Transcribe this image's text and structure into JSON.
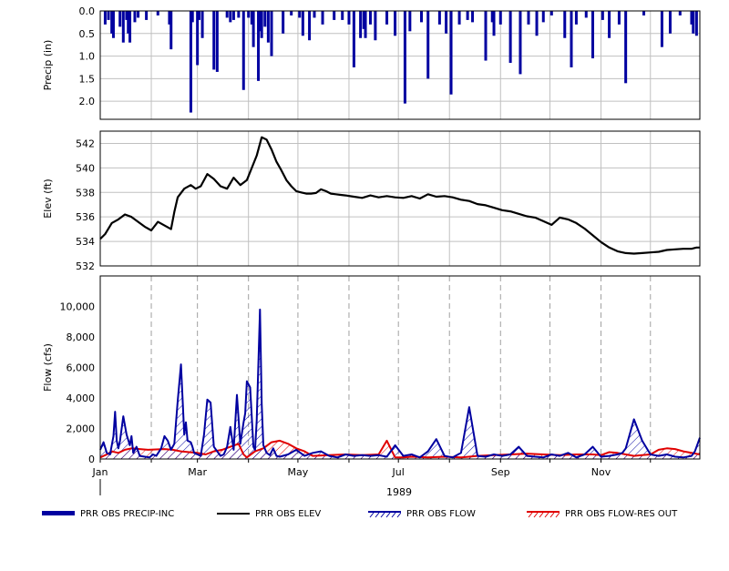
{
  "chart_data": [
    {
      "type": "bar",
      "panel": "precip",
      "ylabel": "Precip (in)",
      "y_inverted": true,
      "ylim": [
        0,
        2.4
      ],
      "yticks": [
        "0.0",
        "0.5",
        "1.0",
        "1.5",
        "2.0"
      ],
      "grid": true,
      "series": [
        {
          "name": "PRR OBS PRECIP-INC",
          "color": "#0000a0",
          "x_day_of_year": [
            4,
            6,
            8,
            9,
            13,
            15,
            17,
            18,
            19,
            22,
            24,
            29,
            36,
            43,
            44,
            56,
            57,
            60,
            61,
            63,
            70,
            72,
            78,
            80,
            82,
            85,
            88,
            91,
            93,
            94,
            97,
            98,
            99,
            101,
            103,
            105,
            112,
            117,
            122,
            124,
            128,
            131,
            136,
            143,
            148,
            152,
            155,
            159,
            161,
            162,
            165,
            168,
            175,
            180,
            186,
            189,
            196,
            200,
            207,
            211,
            214,
            219,
            224,
            227,
            235,
            239,
            240,
            244,
            250,
            256,
            261,
            266,
            270,
            275,
            283,
            287,
            290,
            296,
            300,
            306,
            310,
            316,
            320,
            331,
            342,
            347,
            353,
            360,
            361,
            363
          ],
          "values": [
            0.3,
            0.2,
            0.5,
            0.6,
            0.35,
            0.7,
            0.2,
            0.5,
            0.7,
            0.25,
            0.15,
            0.2,
            0.1,
            0.3,
            0.85,
            2.25,
            0.25,
            1.2,
            0.2,
            0.6,
            1.3,
            1.35,
            0.15,
            0.25,
            0.2,
            0.15,
            1.75,
            0.15,
            0.3,
            0.8,
            1.55,
            0.45,
            0.6,
            0.35,
            0.7,
            1.0,
            0.5,
            0.1,
            0.15,
            0.55,
            0.65,
            0.15,
            0.3,
            0.2,
            0.2,
            0.3,
            1.25,
            0.6,
            0.4,
            0.6,
            0.3,
            0.65,
            0.3,
            0.55,
            2.05,
            0.45,
            0.25,
            1.5,
            0.3,
            0.5,
            1.85,
            0.3,
            0.2,
            0.25,
            1.1,
            0.25,
            0.55,
            0.3,
            1.15,
            1.4,
            0.3,
            0.55,
            0.25,
            0.1,
            0.6,
            1.25,
            0.3,
            0.15,
            1.05,
            0.2,
            0.6,
            0.3,
            1.6,
            0.1,
            0.8,
            0.5,
            0.1,
            0.3,
            0.5,
            0.55
          ]
        }
      ]
    },
    {
      "type": "line",
      "panel": "elev",
      "ylabel": "Elev (ft)",
      "ylim": [
        532,
        543
      ],
      "yticks": [
        "532",
        "534",
        "536",
        "538",
        "540",
        "542"
      ],
      "grid": true,
      "series": [
        {
          "name": "PRR OBS ELEV",
          "color": "#000000",
          "x_day_of_year": [
            1,
            4,
            8,
            12,
            16,
            20,
            24,
            28,
            32,
            36,
            40,
            44,
            46,
            48,
            52,
            56,
            59,
            62,
            66,
            70,
            74,
            78,
            82,
            86,
            90,
            93,
            96,
            99,
            102,
            105,
            108,
            111,
            114,
            117,
            120,
            123,
            126,
            129,
            132,
            135,
            138,
            141,
            144,
            147,
            150,
            155,
            160,
            165,
            170,
            175,
            180,
            185,
            190,
            195,
            200,
            205,
            210,
            215,
            220,
            225,
            230,
            235,
            240,
            245,
            250,
            255,
            260,
            265,
            270,
            275,
            280,
            285,
            290,
            295,
            300,
            305,
            310,
            315,
            320,
            325,
            330,
            335,
            340,
            345,
            350,
            355,
            360,
            363,
            365
          ],
          "values": [
            534.2,
            534.6,
            535.5,
            535.8,
            536.2,
            536.0,
            535.6,
            535.2,
            534.9,
            535.6,
            535.3,
            535.0,
            536.4,
            537.6,
            538.3,
            538.6,
            538.3,
            538.5,
            539.5,
            539.1,
            538.5,
            538.3,
            539.2,
            538.6,
            539.0,
            540.0,
            541.0,
            542.5,
            542.3,
            541.5,
            540.5,
            539.8,
            539.0,
            538.5,
            538.1,
            538.0,
            537.9,
            537.9,
            537.95,
            538.25,
            538.1,
            537.9,
            537.85,
            537.8,
            537.75,
            537.65,
            537.55,
            537.75,
            537.6,
            537.7,
            537.6,
            537.55,
            537.7,
            537.5,
            537.85,
            537.65,
            537.7,
            537.6,
            537.4,
            537.3,
            537.05,
            536.95,
            536.75,
            536.55,
            536.45,
            536.25,
            536.05,
            535.95,
            535.65,
            535.35,
            535.95,
            535.8,
            535.5,
            535.05,
            534.5,
            533.95,
            533.5,
            533.2,
            533.05,
            533.0,
            533.05,
            533.1,
            533.15,
            533.3,
            533.35,
            533.4,
            533.4,
            533.5,
            533.5
          ]
        }
      ]
    },
    {
      "type": "area",
      "panel": "flow",
      "ylabel": "Flow (cfs)",
      "ylim": [
        0,
        12000
      ],
      "yticks": [
        "0",
        "2,000",
        "4,000",
        "6,000",
        "8,000",
        "10,000"
      ],
      "xlabel": "1989",
      "xticks": [
        "Jan",
        "Mar",
        "May",
        "Jul",
        "Sep",
        "Nov"
      ],
      "grid": true,
      "series": [
        {
          "name": "PRR OBS FLOW",
          "color": "#0000a0",
          "x_day_of_year": [
            1,
            3,
            5,
            7,
            9,
            10,
            11,
            12,
            13,
            15,
            17,
            19,
            20,
            21,
            23,
            25,
            28,
            31,
            33,
            35,
            38,
            40,
            42,
            44,
            46,
            48,
            50,
            52,
            53,
            54,
            56,
            57,
            58,
            60,
            62,
            64,
            66,
            68,
            70,
            72,
            74,
            76,
            78,
            80,
            82,
            84,
            86,
            88,
            89,
            90,
            92,
            94,
            95,
            96,
            98,
            99,
            100,
            102,
            104,
            106,
            108,
            110,
            115,
            120,
            125,
            130,
            135,
            140,
            145,
            150,
            155,
            160,
            165,
            170,
            175,
            180,
            185,
            190,
            195,
            200,
            205,
            210,
            215,
            220,
            225,
            230,
            235,
            240,
            245,
            250,
            255,
            260,
            265,
            270,
            275,
            280,
            285,
            290,
            295,
            300,
            305,
            310,
            315,
            318,
            320,
            325,
            330,
            335,
            340,
            345,
            350,
            355,
            360,
            362,
            365
          ],
          "values": [
            600,
            1100,
            400,
            300,
            1500,
            3100,
            1200,
            700,
            1200,
            2800,
            1600,
            900,
            1500,
            400,
            800,
            200,
            150,
            100,
            300,
            200,
            700,
            1500,
            1200,
            600,
            1000,
            3800,
            6200,
            1600,
            2400,
            1200,
            1100,
            800,
            400,
            300,
            200,
            1600,
            3900,
            3700,
            800,
            500,
            200,
            300,
            800,
            2100,
            600,
            4200,
            1000,
            2400,
            3000,
            5100,
            4700,
            800,
            600,
            2500,
            9800,
            3600,
            900,
            400,
            250,
            700,
            200,
            150,
            300,
            600,
            200,
            400,
            500,
            200,
            100,
            300,
            200,
            250,
            200,
            250,
            150,
            900,
            200,
            300,
            100,
            500,
            1300,
            200,
            100,
            400,
            3400,
            200,
            150,
            300,
            200,
            300,
            800,
            200,
            150,
            100,
            300,
            200,
            400,
            100,
            300,
            800,
            150,
            200,
            300,
            400,
            700,
            2600,
            1200,
            300,
            200,
            300,
            150,
            100,
            200,
            500,
            1400
          ]
        },
        {
          "name": "PRR OBS FLOW-RES OUT",
          "color": "#e00000",
          "x_day_of_year": [
            1,
            5,
            8,
            12,
            16,
            20,
            25,
            30,
            40,
            45,
            50,
            55,
            60,
            65,
            70,
            75,
            80,
            85,
            88,
            90,
            95,
            100,
            105,
            110,
            115,
            120,
            125,
            130,
            140,
            150,
            160,
            170,
            175,
            180,
            185,
            190,
            200,
            210,
            220,
            230,
            240,
            250,
            260,
            270,
            280,
            290,
            300,
            305,
            310,
            315,
            320,
            325,
            330,
            335,
            340,
            345,
            350,
            355,
            365
          ],
          "values": [
            100,
            300,
            500,
            400,
            600,
            700,
            650,
            600,
            650,
            600,
            500,
            450,
            400,
            300,
            500,
            600,
            800,
            1000,
            300,
            100,
            500,
            700,
            1100,
            1200,
            1000,
            700,
            500,
            200,
            250,
            300,
            250,
            300,
            1200,
            100,
            100,
            150,
            100,
            150,
            100,
            200,
            250,
            300,
            350,
            300,
            250,
            300,
            300,
            250,
            450,
            400,
            300,
            200,
            250,
            300,
            600,
            700,
            650,
            500,
            300
          ]
        }
      ]
    }
  ],
  "legend": {
    "precip": "PRR OBS PRECIP-INC",
    "elev": "PRR OBS ELEV",
    "flow": "PRR OBS FLOW",
    "resout": "PRR OBS FLOW-RES OUT"
  },
  "colors": {
    "precip": "#0000a0",
    "elev": "#000000",
    "flow": "#0000a0",
    "resout": "#e00000",
    "grid": "#c0c0c0",
    "vgrid": "#a0a0a0"
  }
}
